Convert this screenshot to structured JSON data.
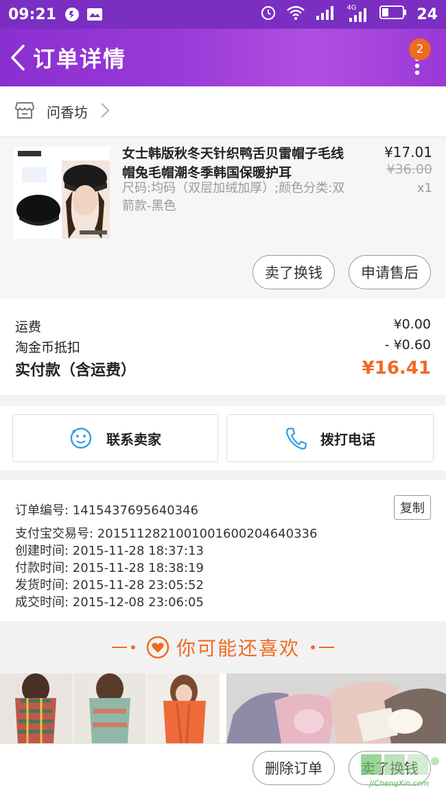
{
  "status_bar": {
    "time": "09:21",
    "battery": "24",
    "network": "4G"
  },
  "nav": {
    "title": "订单详情",
    "badge": "2"
  },
  "shop": {
    "name": "问香坊"
  },
  "product": {
    "name": "女士韩版秋冬天针织鸭舌贝雷帽子毛线帽兔毛帽潮冬季韩国保暖护耳",
    "spec": "尺码:均码（双层加绒加厚）;颜色分类:双箭款-黑色",
    "price": "¥17.01",
    "original_price": "¥36.00",
    "qty": "x1",
    "sell_button": "卖了换钱",
    "after_sale_button": "申请售后"
  },
  "fees": {
    "shipping_label": "运费",
    "shipping_value": "¥0.00",
    "coin_label": "淘金币抵扣",
    "coin_value": "- ¥0.60",
    "total_label": "实付款（含运费）",
    "total_value": "¥16.41"
  },
  "contact": {
    "seller_label": "联系卖家",
    "phone_label": "拨打电话"
  },
  "order_info": {
    "order_no": "订单编号: 1415437695640346",
    "copy_label": "复制",
    "alipay_no": "支付宝交易号: 2015112821001001600204640336",
    "created": "创建时间: 2015-11-28 18:37:13",
    "paid": "付款时间: 2015-11-28 18:38:19",
    "shipped": "发货时间: 2015-11-28 23:05:52",
    "completed": "成交时间: 2015-12-08 23:06:05"
  },
  "recommend": {
    "title": "你可能还喜欢"
  },
  "bottom": {
    "delete_label": "删除订单",
    "sell_label": "卖了换钱"
  },
  "watermark": {
    "site": "JiChengXin.com"
  },
  "colors": {
    "purple": "#8a2fd0",
    "orange": "#f06a20",
    "blue": "#3aa0e0"
  }
}
